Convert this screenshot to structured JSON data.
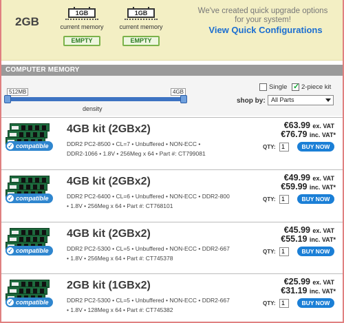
{
  "memory_panel": {
    "capacity": "2GB",
    "slots": [
      {
        "chip_label": "1GB",
        "caption": "current memory"
      },
      {
        "chip_label": "1GB",
        "caption": "current memory"
      },
      {
        "chip_label": "EMPTY"
      },
      {
        "chip_label": "EMPTY"
      }
    ],
    "upgrade_message": "We've created quick upgrade options for your system!",
    "upgrade_link": "View Quick Configurations"
  },
  "section": {
    "title": "COMPUTER MEMORY"
  },
  "density_slider": {
    "min_label": "512MB",
    "max_label": "4GB",
    "label": "density"
  },
  "filters": {
    "single": {
      "label": "Single",
      "checked": false
    },
    "two_piece": {
      "label": "2-piece kit",
      "checked": true
    },
    "shop_by_label": "shop by:",
    "shop_by_value": "All Parts"
  },
  "badge_label": "compatible",
  "qty_label": "QTY:",
  "buy_label": "BUY NOW",
  "ex_vat_suffix": "ex. VAT",
  "inc_vat_suffix": "inc. VAT*",
  "products": [
    {
      "title": "4GB kit (2GBx2)",
      "desc_line1": "DDR2 PC2-8500 • CL=7 • Unbuffered • NON-ECC •",
      "desc_line2": "DDR2-1066 • 1.8V • 256Meg x 64 •   Part #: CT799081",
      "price_ex": "€63.99",
      "price_inc": "€76.79",
      "qty": "1"
    },
    {
      "title": "4GB kit (2GBx2)",
      "desc_line1": "DDR2 PC2-6400 • CL=6 • Unbuffered • NON-ECC • DDR2-800",
      "desc_line2": "• 1.8V • 256Meg x 64 •   Part #: CT768101",
      "price_ex": "€49.99",
      "price_inc": "€59.99",
      "qty": "1"
    },
    {
      "title": "4GB kit (2GBx2)",
      "desc_line1": "DDR2 PC2-5300 • CL=5 • Unbuffered • NON-ECC • DDR2-667",
      "desc_line2": "• 1.8V • 256Meg x 64 •   Part #: CT745378",
      "price_ex": "€45.99",
      "price_inc": "€55.19",
      "qty": "1"
    },
    {
      "title": "2GB kit (1GBx2)",
      "desc_line1": "DDR2 PC2-5300 • CL=5 • Unbuffered • NON-ECC • DDR2-667",
      "desc_line2": "• 1.8V • 128Meg x 64 •   Part #: CT745382",
      "price_ex": "€25.99",
      "price_inc": "€31.19",
      "qty": "1"
    }
  ]
}
